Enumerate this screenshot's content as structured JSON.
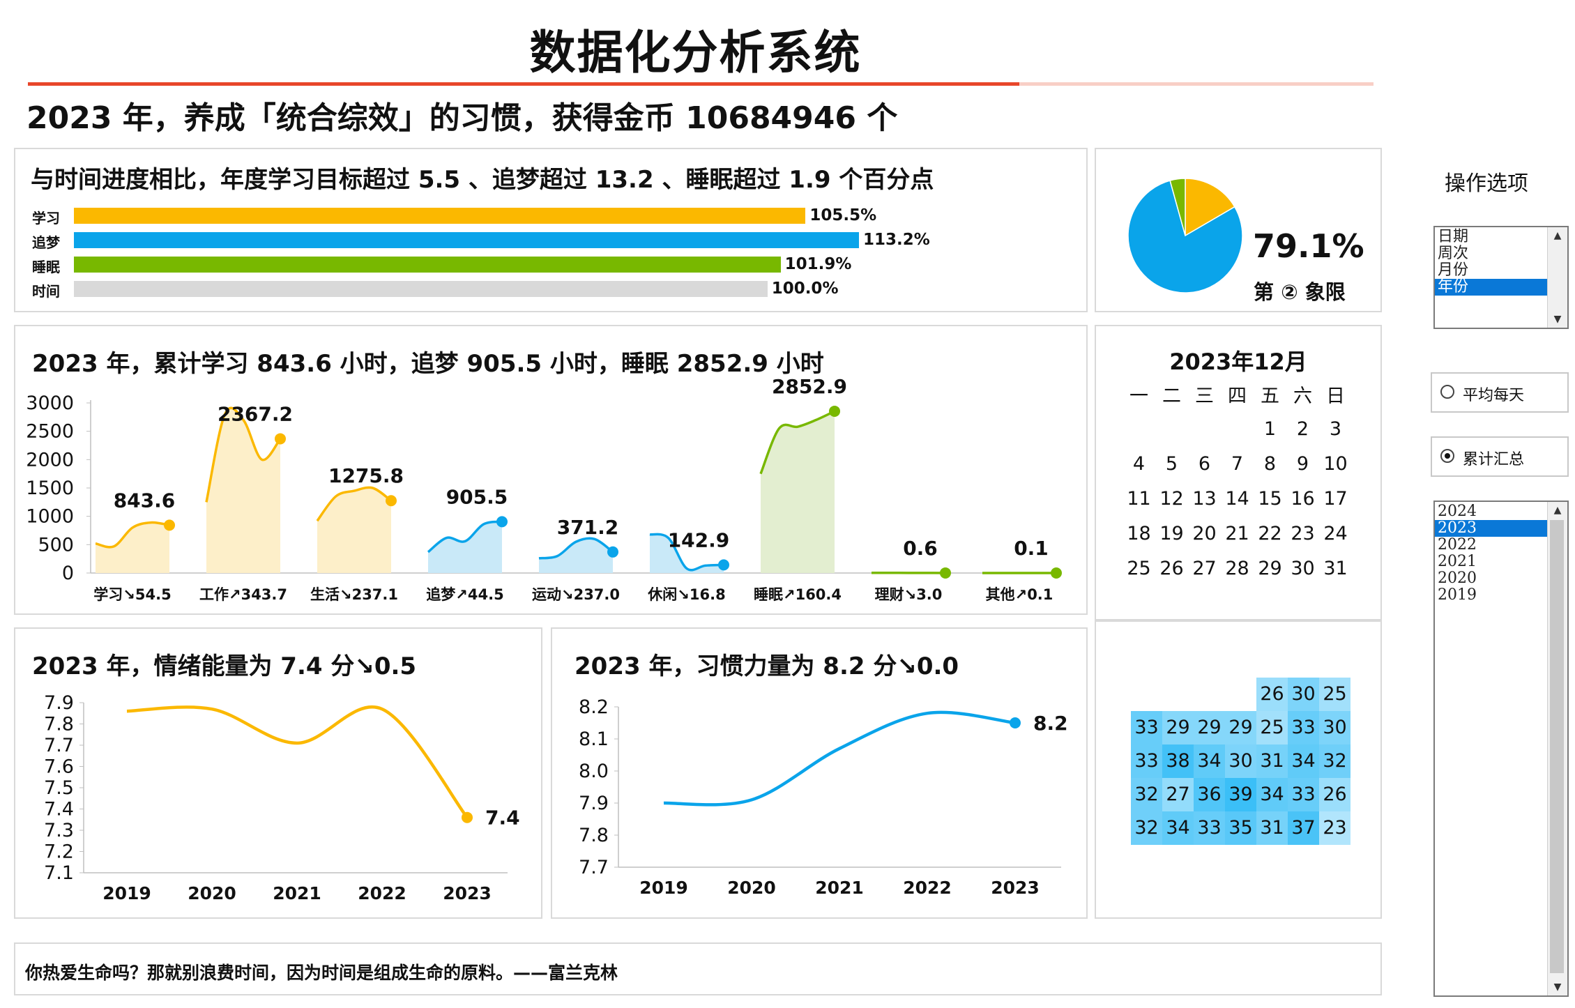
{
  "app_title": "数据化分析系统",
  "headline": "2023 年，养成「统合综效」的习惯，获得金币 10684946 个",
  "progress_panel": {
    "title": "与时间进度相比，年度学习目标超过 5.5 、追梦超过 13.2 、睡眠超过 1.9 个百分点",
    "bars": [
      {
        "label": "学习",
        "value": 105.5,
        "value_label": "105.5%",
        "color": "#fbb800"
      },
      {
        "label": "追梦",
        "value": 113.2,
        "value_label": "113.2%",
        "color": "#0aa4ea"
      },
      {
        "label": "睡眠",
        "value": 101.9,
        "value_label": "101.9%",
        "color": "#78b800"
      },
      {
        "label": "时间",
        "value": 100.0,
        "value_label": "100.0%",
        "color": "#d9d9d9"
      }
    ]
  },
  "pie_panel": {
    "percent": "79.1%",
    "quadrant": "第 ② 象限",
    "slices": [
      {
        "value": 16.6,
        "color": "#fbb800"
      },
      {
        "value": 79.1,
        "color": "#0aa4ea"
      },
      {
        "value": 4.3,
        "color": "#78b800"
      }
    ]
  },
  "hours_panel": {
    "title": "2023 年，累计学习 843.6 小时，追梦 905.5 小时，睡眠 2852.9 小时"
  },
  "calendar": {
    "title": "2023年12月",
    "weekdays": [
      "一",
      "二",
      "三",
      "四",
      "五",
      "六",
      "日"
    ],
    "rows": [
      [
        "",
        "",
        "",
        "",
        "1",
        "2",
        "3"
      ],
      [
        "4",
        "5",
        "6",
        "7",
        "8",
        "9",
        "10"
      ],
      [
        "11",
        "12",
        "13",
        "14",
        "15",
        "16",
        "17"
      ],
      [
        "18",
        "19",
        "20",
        "21",
        "22",
        "23",
        "24"
      ],
      [
        "25",
        "26",
        "27",
        "28",
        "29",
        "30",
        "31"
      ]
    ]
  },
  "heatmap": {
    "rows": [
      [
        "",
        "",
        "",
        "",
        "26",
        "30",
        "25"
      ],
      [
        "33",
        "29",
        "29",
        "29",
        "25",
        "33",
        "30"
      ],
      [
        "33",
        "38",
        "34",
        "30",
        "31",
        "34",
        "32"
      ],
      [
        "32",
        "27",
        "36",
        "39",
        "34",
        "33",
        "26"
      ],
      [
        "32",
        "34",
        "33",
        "35",
        "31",
        "37",
        "23"
      ]
    ]
  },
  "emotion_panel": {
    "title": "2023 年，情绪能量为 7.4 分↘0.5"
  },
  "habit_panel": {
    "title": "2023 年，习惯力量为 8.2 分↘0.0"
  },
  "quote": "你热爱生命吗？那就别浪费时间，因为时间是组成生命的原料。——富兰克林",
  "options": {
    "title": "操作选项",
    "period_items": [
      "日期",
      "周次",
      "月份",
      "年份"
    ],
    "period_selected": "年份",
    "radio_avg": "平均每天",
    "radio_total": "累计汇总",
    "radio_selected": "累计汇总",
    "year_items": [
      "2024",
      "2023",
      "2022",
      "2021",
      "2020",
      "2019"
    ],
    "year_selected": "2023"
  },
  "chart_data": [
    {
      "type": "bar",
      "title": "与时间进度相比，年度学习目标超过 5.5 、追梦超过 13.2 、睡眠超过 1.9 个百分点",
      "categories": [
        "学习",
        "追梦",
        "睡眠",
        "时间"
      ],
      "values": [
        105.5,
        113.2,
        101.9,
        100.0
      ]
    },
    {
      "type": "pie",
      "values": [
        16.6,
        79.1,
        4.3
      ]
    },
    {
      "type": "area",
      "title": "2023 年，累计学习 843.6 小时，追梦 905.5 小时，睡眠 2852.9 小时",
      "ylim": [
        0,
        3000
      ],
      "yticks": [
        0,
        500,
        1000,
        1500,
        2000,
        2500,
        3000
      ],
      "series": [
        {
          "name": "学习",
          "category_label": "学习↘54.5",
          "value_label": "843.6",
          "values": [
            520,
            470,
            800,
            890,
            843.6
          ],
          "color": "#fbb800",
          "fill": "#fdefc9"
        },
        {
          "name": "工作",
          "category_label": "工作↗343.7",
          "value_label": "2367.2",
          "values": [
            1250,
            2800,
            2700,
            2000,
            2367.2
          ],
          "color": "#fbb800",
          "fill": "#fdefc9"
        },
        {
          "name": "生活",
          "category_label": "生活↘237.1",
          "value_label": "1275.8",
          "values": [
            920,
            1350,
            1450,
            1500,
            1275.8
          ],
          "color": "#fbb800",
          "fill": "#fdefc9"
        },
        {
          "name": "追梦",
          "category_label": "追梦↗44.5",
          "value_label": "905.5",
          "values": [
            370,
            620,
            560,
            860,
            905.5
          ],
          "color": "#0aa4ea",
          "fill": "#c9e9f8"
        },
        {
          "name": "运动",
          "category_label": "运动↘237.0",
          "value_label": "371.2",
          "values": [
            260,
            300,
            550,
            600,
            371.2
          ],
          "color": "#0aa4ea",
          "fill": "#c9e9f8"
        },
        {
          "name": "休闲",
          "category_label": "休闲↘16.8",
          "value_label": "142.9",
          "values": [
            680,
            620,
            80,
            130,
            142.9
          ],
          "color": "#0aa4ea",
          "fill": "#c9e9f8"
        },
        {
          "name": "睡眠",
          "category_label": "睡眠↗160.4",
          "value_label": "2852.9",
          "values": [
            1750,
            2550,
            2580,
            2700,
            2852.9
          ],
          "color": "#78b800",
          "fill": "#e3eed0"
        },
        {
          "name": "理财",
          "category_label": "理财↘3.0",
          "value_label": "0.6",
          "values": [
            3.6,
            3.0,
            2.0,
            1.0,
            0.6
          ],
          "color": "#78b800",
          "fill": "#e3eed0"
        },
        {
          "name": "其他",
          "category_label": "其他↗0.1",
          "value_label": "0.1",
          "values": [
            0,
            0,
            0.1,
            0.1,
            0.1
          ],
          "color": "#78b800",
          "fill": "#e3eed0"
        }
      ]
    },
    {
      "type": "line",
      "title": "2023 年，情绪能量为 7.4 分↘0.5",
      "x": [
        "2019",
        "2020",
        "2021",
        "2022",
        "2023"
      ],
      "values": [
        7.86,
        7.87,
        7.71,
        7.87,
        7.36
      ],
      "end_label": "7.4",
      "ylim": [
        7.1,
        7.9
      ],
      "yticks": [
        "7.1",
        "7.2",
        "7.3",
        "7.4",
        "7.5",
        "7.6",
        "7.7",
        "7.8",
        "7.9"
      ],
      "color": "#fbb800"
    },
    {
      "type": "line",
      "title": "2023 年，习惯力量为 8.2 分↘0.0",
      "x": [
        "2019",
        "2020",
        "2021",
        "2022",
        "2023"
      ],
      "values": [
        7.9,
        7.91,
        8.07,
        8.18,
        8.15
      ],
      "end_label": "8.2",
      "ylim": [
        7.7,
        8.2
      ],
      "yticks": [
        "7.7",
        "7.8",
        "7.9",
        "8.0",
        "8.1",
        "8.2"
      ],
      "color": "#0aa4ea"
    }
  ]
}
